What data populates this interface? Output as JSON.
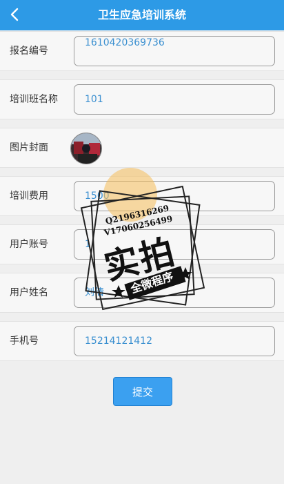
{
  "header": {
    "title": "卫生应急培训系统"
  },
  "fields": [
    {
      "label": "报名编号",
      "value": "1610420369736"
    },
    {
      "label": "培训班名称",
      "value": "101"
    },
    {
      "label": "图片封面"
    },
    {
      "label": "培训费用",
      "value": "1500"
    },
    {
      "label": "用户账号",
      "value": "1"
    },
    {
      "label": "用户姓名",
      "value": "刘倩"
    },
    {
      "label": "手机号",
      "value": "15214121412"
    }
  ],
  "submit_label": "提交",
  "watermark": {
    "line1": "Q2196316269",
    "line2": "V17060256499",
    "big": "实拍",
    "small": "全微程序"
  }
}
